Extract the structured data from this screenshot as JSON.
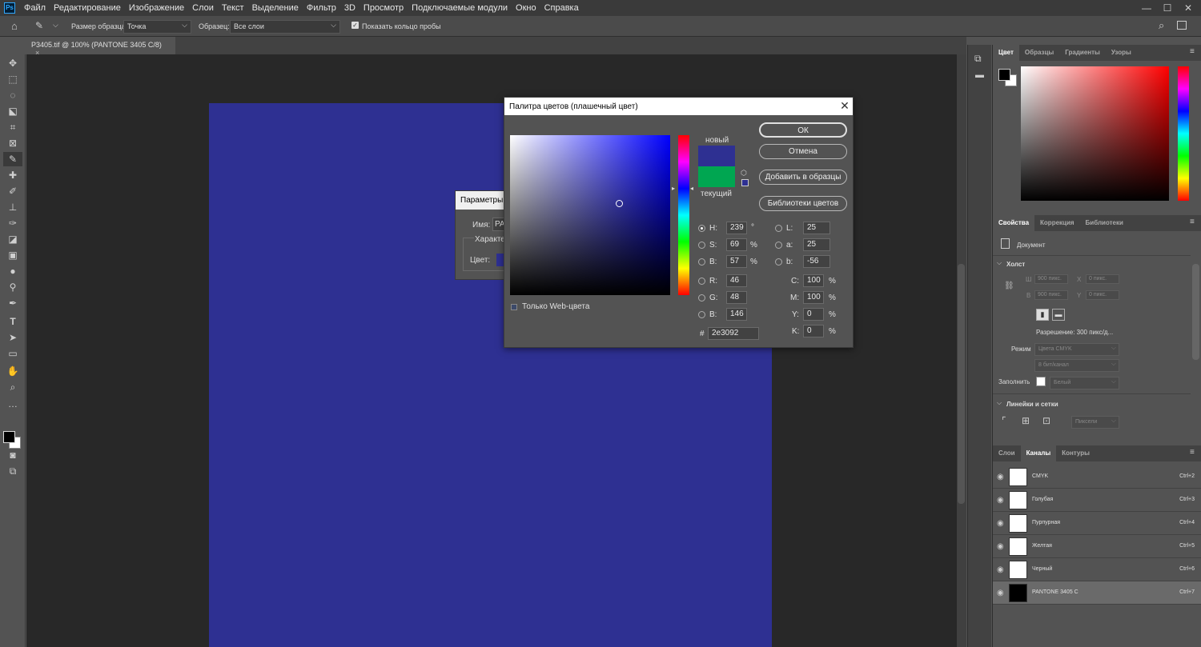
{
  "app": {
    "logo": "Ps"
  },
  "menubar": [
    "Файл",
    "Редактирование",
    "Изображение",
    "Слои",
    "Текст",
    "Выделение",
    "Фильтр",
    "3D",
    "Просмотр",
    "Подключаемые модули",
    "Окно",
    "Справка"
  ],
  "window_controls": {
    "minimize": "—",
    "maximize": "☐",
    "close": "✕"
  },
  "options": {
    "sample_size_label": "Размер образца:",
    "sample_size_value": "Точка",
    "sample_label": "Образец:",
    "sample_value": "Все слои",
    "show_ring_label": "Показать кольцо пробы"
  },
  "document_tab": {
    "title": "P3405.tif @ 100% (PANTONE 3405 C/8)",
    "close": "×"
  },
  "doc_color": "#2e3092",
  "color_panel": {
    "tabs": [
      "Цвет",
      "Образцы",
      "Градиенты",
      "Узоры"
    ]
  },
  "properties_panel": {
    "tabs": [
      "Свойства",
      "Коррекция",
      "Библиотеки"
    ],
    "doc_label": "Документ",
    "canvas_section": "Холст",
    "w_label": "Ш",
    "w_value": "900 пикс.",
    "h_label": "В",
    "h_value": "900 пикс.",
    "x_label": "X",
    "x_value": "0 пикс.",
    "y_label": "Y",
    "y_value": "0 пикс.",
    "resolution": "Разрешение: 300 пикс/д...",
    "mode_label": "Режим",
    "mode_value": "Цвета CMYK",
    "depth_value": "8 бит/канал",
    "fill_label": "Заполнить",
    "fill_value": "Белый",
    "rulers_section": "Линейки и сетки",
    "units_value": "Пиксели"
  },
  "channels_panel": {
    "tabs": [
      "Слои",
      "Каналы",
      "Контуры"
    ],
    "rows": [
      {
        "name": "CMYK",
        "shortcut": "Ctrl+2"
      },
      {
        "name": "Голубая",
        "shortcut": "Ctrl+3"
      },
      {
        "name": "Пурпурная",
        "shortcut": "Ctrl+4"
      },
      {
        "name": "Желтая",
        "shortcut": "Ctrl+5"
      },
      {
        "name": "Черный",
        "shortcut": "Ctrl+6"
      },
      {
        "name": "PANTONE 3405 C",
        "shortcut": "Ctrl+7"
      }
    ]
  },
  "params_dialog": {
    "title": "Параметры",
    "name_label": "Имя:",
    "name_value": "PA",
    "group_label": "Характе",
    "color_label": "Цвет:"
  },
  "picker": {
    "title": "Палитра цветов (плашечный цвет)",
    "close": "✕",
    "new_label": "новый",
    "current_label": "текущий",
    "new_color": "#2e3092",
    "current_color": "#00a651",
    "ok": "ОК",
    "cancel": "Отмена",
    "add_swatch": "Добавить в образцы",
    "libraries": "Библиотеки цветов",
    "web_only": "Только Web-цвета",
    "H_label": "H:",
    "H": "239",
    "H_unit": "°",
    "S_label": "S:",
    "S": "69",
    "S_unit": "%",
    "B_label": "B:",
    "B": "57",
    "B_unit": "%",
    "R_label": "R:",
    "R": "46",
    "G_label": "G:",
    "G": "48",
    "Bl_label": "B:",
    "Bl": "146",
    "L_label": "L:",
    "L": "25",
    "a_label": "a:",
    "a": "25",
    "b_label": "b:",
    "b": "-56",
    "C_label": "C:",
    "C": "100",
    "C_unit": "%",
    "M_label": "M:",
    "M": "100",
    "M_unit": "%",
    "Y_label": "Y:",
    "Y": "0",
    "Y_unit": "%",
    "K_label": "K:",
    "K": "0",
    "K_unit": "%",
    "hex_label": "#",
    "hex": "2e3092"
  }
}
